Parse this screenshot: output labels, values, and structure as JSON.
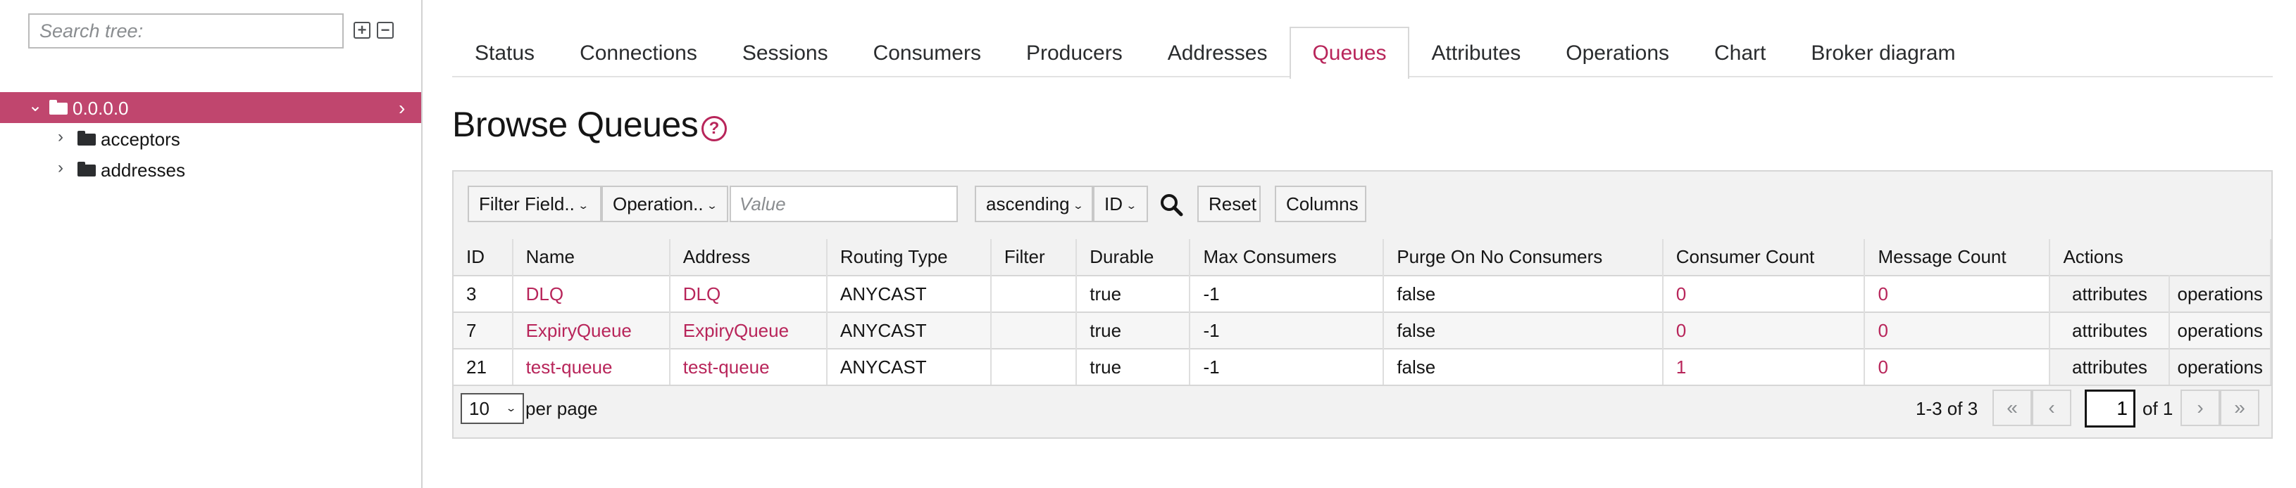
{
  "sidebar": {
    "search_placeholder": "Search tree:",
    "expand_all_glyph": "+",
    "collapse_all_glyph": "−",
    "root": {
      "label": "0.0.0.0",
      "caret": "⌄",
      "arrow": "›"
    },
    "children": [
      {
        "label": "acceptors",
        "caret": "›"
      },
      {
        "label": "addresses",
        "caret": "›"
      }
    ]
  },
  "tabs": [
    {
      "label": "Status",
      "active": false
    },
    {
      "label": "Connections",
      "active": false
    },
    {
      "label": "Sessions",
      "active": false
    },
    {
      "label": "Consumers",
      "active": false
    },
    {
      "label": "Producers",
      "active": false
    },
    {
      "label": "Addresses",
      "active": false
    },
    {
      "label": "Queues",
      "active": true
    },
    {
      "label": "Attributes",
      "active": false
    },
    {
      "label": "Operations",
      "active": false
    },
    {
      "label": "Chart",
      "active": false
    },
    {
      "label": "Broker diagram",
      "active": false
    }
  ],
  "page": {
    "title": "Browse Queues",
    "help_glyph": "?"
  },
  "toolbar": {
    "filter_field": "Filter Field..",
    "operation": "Operation..",
    "value_placeholder": "Value",
    "sort_order": "ascending",
    "sort_field": "ID",
    "reset": "Reset",
    "columns": "Columns",
    "chevron": "⌄"
  },
  "table": {
    "headers": {
      "id": "ID",
      "name": "Name",
      "address": "Address",
      "routing": "Routing Type",
      "filter": "Filter",
      "durable": "Durable",
      "max_consumers": "Max Consumers",
      "purge": "Purge On No Consumers",
      "consumer_count": "Consumer Count",
      "message_count": "Message Count",
      "actions": "Actions"
    },
    "rows": [
      {
        "id": "3",
        "name": "DLQ",
        "address": "DLQ",
        "routing": "ANYCAST",
        "filter": "",
        "durable": "true",
        "max_consumers": "-1",
        "purge": "false",
        "consumer_count": "0",
        "message_count": "0",
        "action1": "attributes",
        "action2": "operations"
      },
      {
        "id": "7",
        "name": "ExpiryQueue",
        "address": "ExpiryQueue",
        "routing": "ANYCAST",
        "filter": "",
        "durable": "true",
        "max_consumers": "-1",
        "purge": "false",
        "consumer_count": "0",
        "message_count": "0",
        "action1": "attributes",
        "action2": "operations"
      },
      {
        "id": "21",
        "name": "test-queue",
        "address": "test-queue",
        "routing": "ANYCAST",
        "filter": "",
        "durable": "true",
        "max_consumers": "-1",
        "purge": "false",
        "consumer_count": "1",
        "message_count": "0",
        "action1": "attributes",
        "action2": "operations"
      }
    ]
  },
  "pagination": {
    "page_size": "10",
    "per_page_label": "per page",
    "range": "1-3 of 3",
    "current_page": "1",
    "of_pages": "of 1",
    "first_glyph": "«",
    "prev_glyph": "‹",
    "next_glyph": "›",
    "last_glyph": "»"
  },
  "colors": {
    "accent": "#b8255a",
    "selected_row": "#c0466e"
  }
}
